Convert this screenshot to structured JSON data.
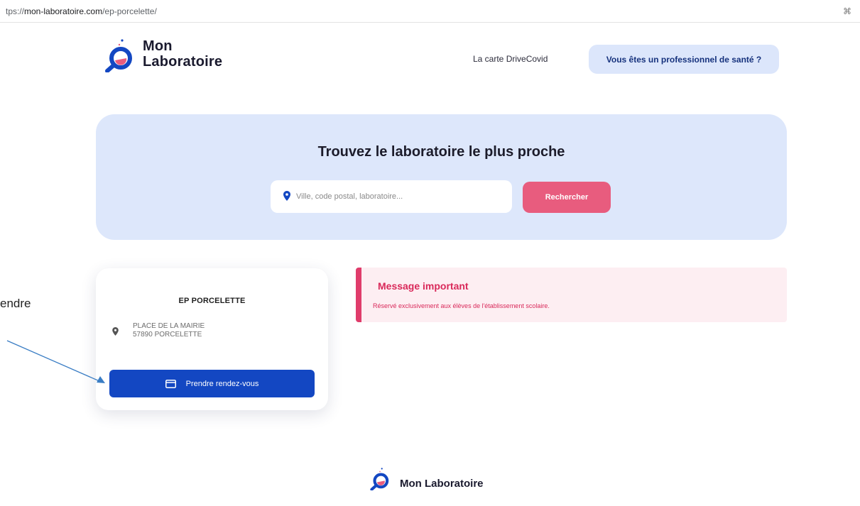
{
  "browser": {
    "url_prefix": "tps://",
    "url_host": "mon-laboratoire.com",
    "url_path": "/ep-porcelette/",
    "corner_icon": "⌘"
  },
  "header": {
    "logo_line1": "Mon",
    "logo_line2": "Laboratoire",
    "nav_link": "La carte DriveCovid",
    "pro_button": "Vous êtes un professionnel de santé ?"
  },
  "search": {
    "title": "Trouvez le laboratoire le plus proche",
    "placeholder": "Ville, code postal, laboratoire...",
    "button": "Rechercher"
  },
  "lab": {
    "name": "EP PORCELETTE",
    "address_line1": "PLACE DE LA MAIRIE",
    "address_line2": "57890 PORCELETTE",
    "appointment_button": "Prendre rendez-vous"
  },
  "message": {
    "title": "Message important",
    "text": "Réservé exclusivement aux élèves de l'établissement scolaire."
  },
  "annotation": {
    "side_text": "endre"
  },
  "footer": {
    "logo_text": "Mon Laboratoire"
  },
  "colors": {
    "brand_blue": "#1347c2",
    "accent_pink": "#e85c7e",
    "panel_blue": "#dde7fb",
    "alert_red": "#d9295a"
  }
}
